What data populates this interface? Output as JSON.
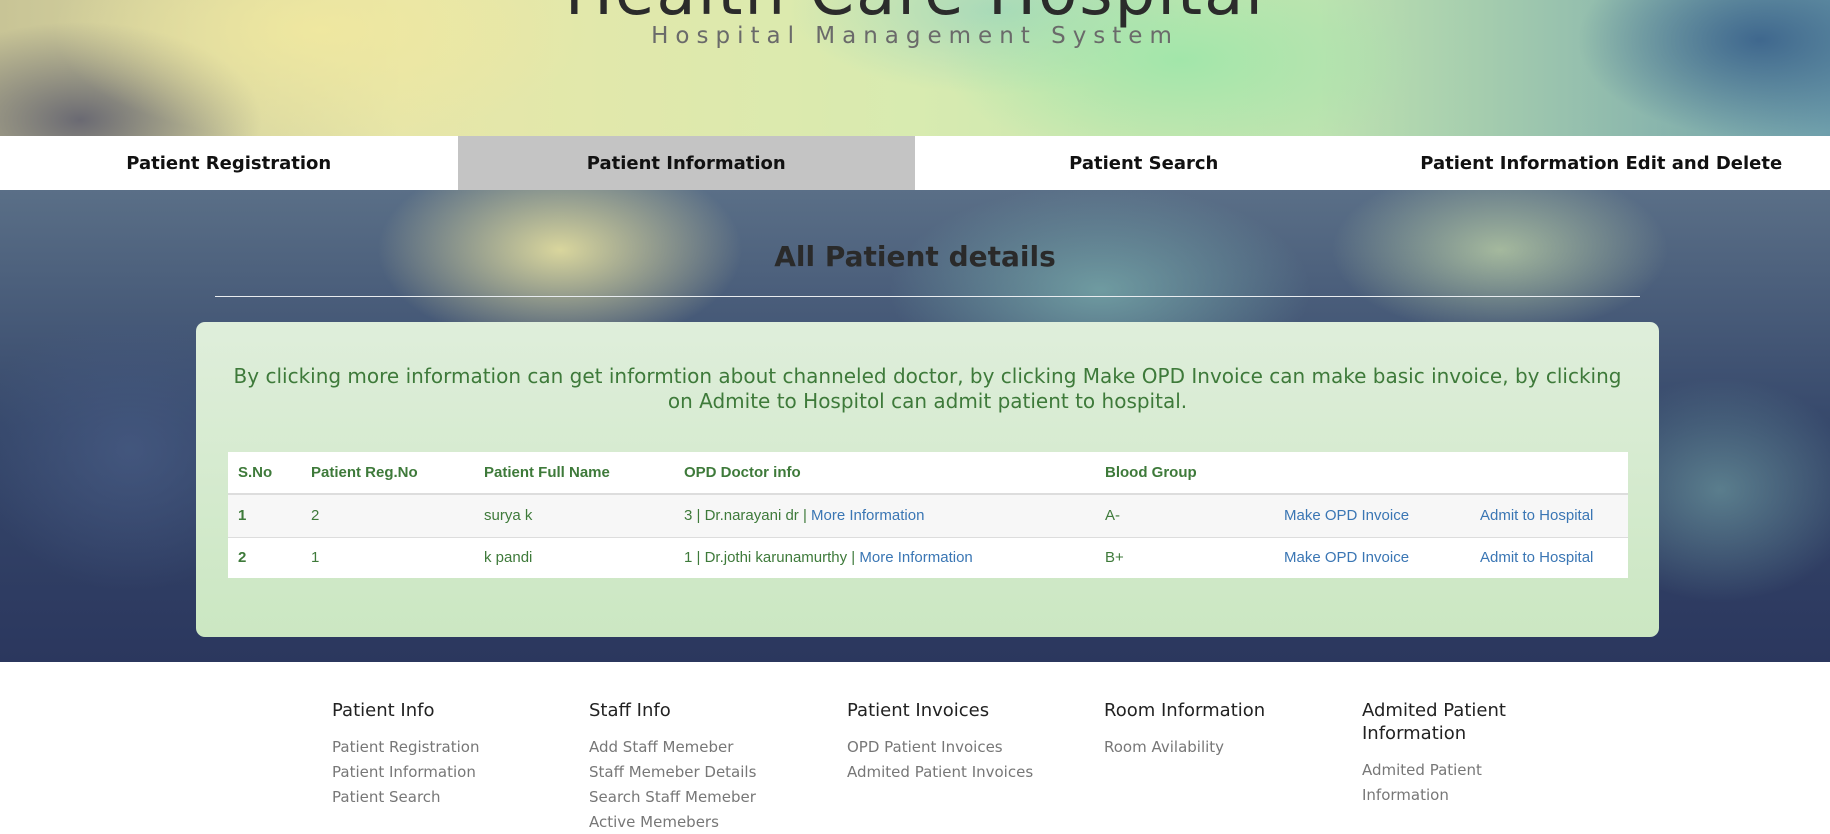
{
  "header": {
    "title": "Health Care Hospital",
    "subtitle": "Hospital Management System"
  },
  "nav": {
    "items": [
      {
        "label": "Patient Registration"
      },
      {
        "label": "Patient Information"
      },
      {
        "label": "Patient Search"
      },
      {
        "label": "Patient Information Edit and Delete"
      }
    ],
    "active": "Patient Information"
  },
  "main": {
    "title": "All Patient details",
    "note": "By clicking more information can get informtion about channeled doctor, by clicking Make OPD Invoice can make basic invoice, by clicking on Admite to Hospitol can admit patient to hospital.",
    "table": {
      "headers": [
        "S.No",
        "Patient Reg.No",
        "Patient Full Name",
        "OPD Doctor info",
        "Blood Group",
        "",
        ""
      ],
      "rows": [
        {
          "sno": "1",
          "reg_no": "2",
          "name": "surya k",
          "doctor": "3 | Dr.narayani dr | ",
          "more": "More Information",
          "blood": "A-",
          "invoice": "Make OPD Invoice",
          "admit": "Admit to Hospital"
        },
        {
          "sno": "2",
          "reg_no": "1",
          "name": "k pandi",
          "doctor": "1 | Dr.jothi karunamurthy | ",
          "more": "More Information",
          "blood": "B+",
          "invoice": "Make OPD Invoice",
          "admit": "Admit to Hospital"
        }
      ]
    }
  },
  "footer": {
    "columns": [
      {
        "title": "Patient Info",
        "links": [
          "Patient Registration",
          "Patient Information",
          "Patient Search"
        ]
      },
      {
        "title": "Staff Info",
        "links": [
          "Add Staff Memeber",
          "Staff Memeber Details",
          "Search Staff Memeber",
          "Active Memebers"
        ]
      },
      {
        "title": "Patient Invoices",
        "links": [
          "OPD Patient Invoices",
          "Admited Patient Invoices"
        ]
      },
      {
        "title": "Room Information",
        "links": [
          "Room Avilability"
        ]
      },
      {
        "title": "Admited Patient Information",
        "links": [
          "Admited Patient Information"
        ]
      }
    ]
  }
}
